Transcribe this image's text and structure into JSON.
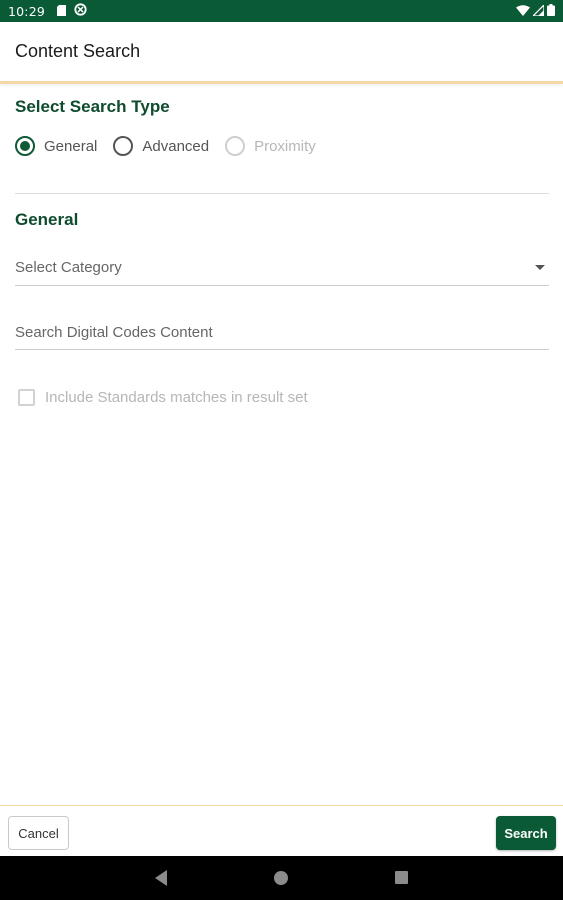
{
  "status_bar": {
    "time": "10:29",
    "icons_left": [
      "sd-card-icon",
      "sync-icon"
    ],
    "icons_right": [
      "wifi-icon",
      "cell-signal-icon",
      "battery-icon"
    ]
  },
  "header": {
    "title": "Content Search"
  },
  "search_type": {
    "title": "Select Search Type",
    "options": [
      {
        "label": "General",
        "selected": true,
        "enabled": true
      },
      {
        "label": "Advanced",
        "selected": false,
        "enabled": true
      },
      {
        "label": "Proximity",
        "selected": false,
        "enabled": false
      }
    ]
  },
  "general": {
    "title": "General",
    "category_placeholder": "Select Category",
    "search_placeholder": "Search Digital Codes Content",
    "include_standards_label": "Include Standards matches in result set",
    "include_standards_checked": false
  },
  "footer": {
    "cancel_label": "Cancel",
    "search_label": "Search"
  },
  "colors": {
    "primary": "#0b5a36",
    "accent_border": "#f6d7a6"
  }
}
